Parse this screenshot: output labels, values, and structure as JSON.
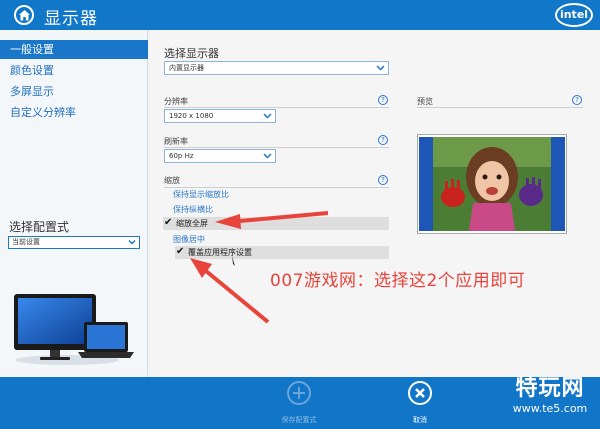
{
  "titlebar": {
    "title": "显示器",
    "brand": "intel"
  },
  "sidebar": {
    "items": [
      {
        "label": "一般设置",
        "active": true
      },
      {
        "label": "颜色设置",
        "active": false
      },
      {
        "label": "多屏显示",
        "active": false
      },
      {
        "label": "自定义分辨率",
        "active": false
      }
    ],
    "profile_label": "选择配置式",
    "profile_value": "当前设置"
  },
  "main": {
    "select_display_label": "选择显示器",
    "select_display_value": "内置显示器",
    "resolution_label": "分辨率",
    "resolution_value": "1920 x 1080",
    "refresh_label": "刷新率",
    "refresh_value": "60p Hz",
    "preview_label": "预览",
    "scaling_label": "缩放",
    "scaling_options": [
      {
        "label": "保持显示缩放比",
        "type": "link"
      },
      {
        "label": "保持纵横比",
        "type": "link"
      },
      {
        "label": "缩放全屏",
        "type": "checkbox",
        "checked": true
      },
      {
        "label": "图像居中",
        "type": "link"
      },
      {
        "label": "覆盖应用程序设置",
        "type": "checkbox",
        "checked": true
      }
    ],
    "help_glyph": "?"
  },
  "annotation": {
    "text": "007游戏网：选择这2个应用即可",
    "color": "#e8443b"
  },
  "bottombar": {
    "save_label": "保存配置式",
    "cancel_label": "取消"
  },
  "watermark": {
    "main": "特玩网",
    "sub": "www.te5.com"
  },
  "colors": {
    "accent": "#1176c8",
    "link": "#2a7acb",
    "annotation": "#e8443b"
  }
}
